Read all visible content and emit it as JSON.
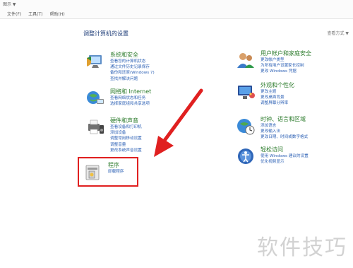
{
  "window": {
    "top_label": "图示 ▼",
    "menus": [
      "文件(F)",
      "工具(T)",
      "帮助(H)"
    ]
  },
  "panel": {
    "header": "调整计算机的设置",
    "view_by": "查看方式 ▼"
  },
  "categories": [
    {
      "title": "系统和安全",
      "icon": "shield-computer-icon",
      "links": [
        "查看您的计算机状态",
        "通过文件历史记录保存",
        "备份和还原(Windows 7)",
        "查找并解决问题"
      ]
    },
    {
      "title": "网络和 Internet",
      "icon": "network-globe-icon",
      "links": [
        "查看网络状态和任务",
        "选择家庭组和共享选项"
      ]
    },
    {
      "title": "硬件和声音",
      "icon": "printer-speaker-icon",
      "links": [
        "查看设备和打印机",
        "添加设备",
        "调整常用移动设置",
        "调整音量",
        "更改系统声音设置"
      ]
    },
    {
      "title": "程序",
      "icon": "programs-icon",
      "links": [
        "卸载程序"
      ]
    },
    {
      "title": "用户帐户和家庭安全",
      "icon": "users-icon",
      "links": [
        "更改帐户类型",
        "为所有用户设置家长控制",
        "更改 Windows 凭据"
      ]
    },
    {
      "title": "外观和个性化",
      "icon": "monitor-palette-icon",
      "links": [
        "更改主题",
        "更改桌面背景",
        "调整屏幕分辨率"
      ]
    },
    {
      "title": "时钟、语言和区域",
      "icon": "clock-globe-icon",
      "links": [
        "添加语言",
        "更改输入法",
        "更改日期、时间或数字格式"
      ]
    },
    {
      "title": "轻松访问",
      "icon": "accessibility-icon",
      "links": [
        "使用 Windows 建议的设置",
        "优化视频显示"
      ]
    }
  ],
  "watermark": "软件技巧",
  "colors": {
    "title_green": "#2a7a2a",
    "link_blue": "#2d61b5",
    "highlight_red": "#e02020"
  }
}
